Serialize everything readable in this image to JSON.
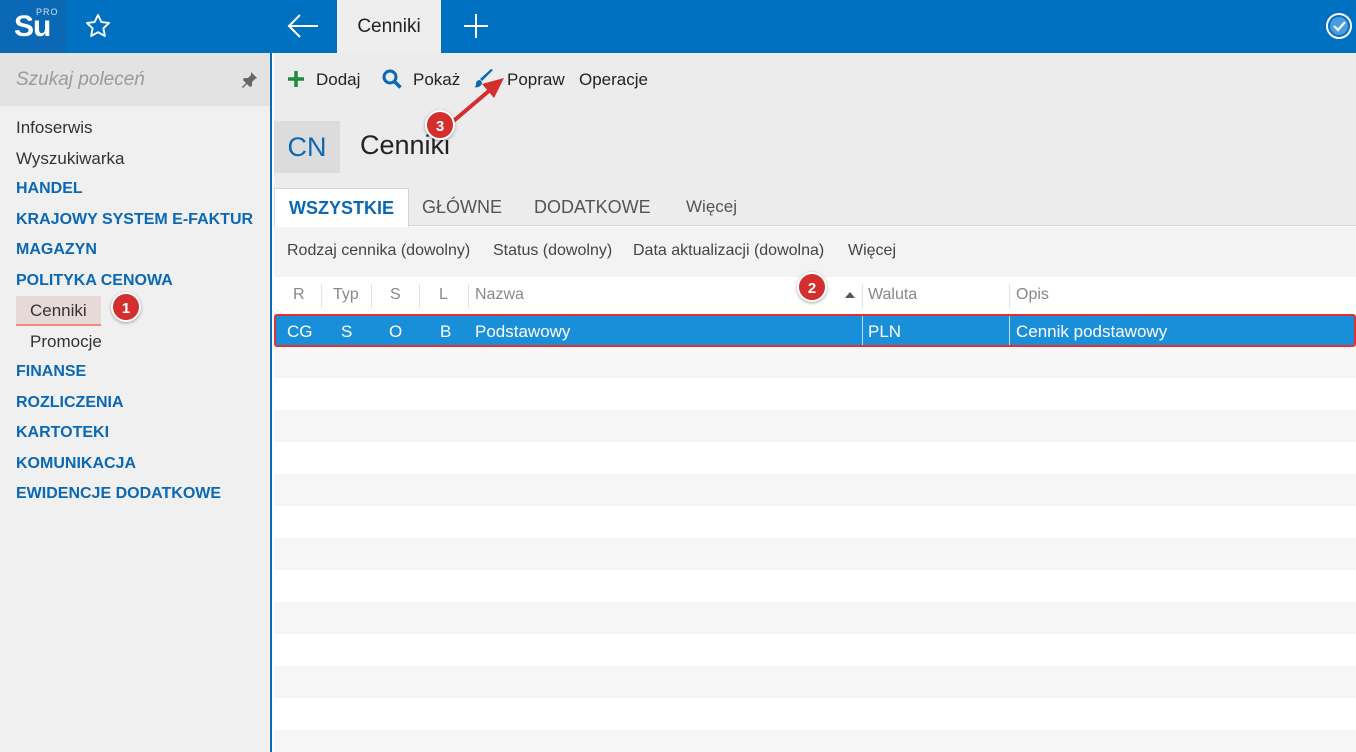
{
  "app": {
    "logo_text": "Su",
    "logo_sup": "PRO",
    "active_tab": "Cenniki"
  },
  "sidebar": {
    "search_placeholder": "Szukaj poleceń",
    "items": [
      {
        "label": "Infoserwis",
        "kind": "item"
      },
      {
        "label": "Wyszukiwarka",
        "kind": "item"
      },
      {
        "label": "HANDEL",
        "kind": "head"
      },
      {
        "label": "KRAJOWY SYSTEM E-FAKTUR",
        "kind": "head"
      },
      {
        "label": "MAGAZYN",
        "kind": "head"
      },
      {
        "label": "POLITYKA CENOWA",
        "kind": "head"
      },
      {
        "label": "Cenniki",
        "kind": "sub-selected"
      },
      {
        "label": "Promocje",
        "kind": "sub"
      },
      {
        "label": "FINANSE",
        "kind": "head"
      },
      {
        "label": "ROZLICZENIA",
        "kind": "head"
      },
      {
        "label": "KARTOTEKI",
        "kind": "head"
      },
      {
        "label": "KOMUNIKACJA",
        "kind": "head"
      },
      {
        "label": "EWIDENCJE DODATKOWE",
        "kind": "head"
      }
    ]
  },
  "toolbar": {
    "add": "Dodaj",
    "show": "Pokaż",
    "edit": "Popraw",
    "operations": "Operacje"
  },
  "header": {
    "code": "CN",
    "title": "Cenniki"
  },
  "tabs": [
    "WSZYSTKIE",
    "GŁÓWNE",
    "DODATKOWE",
    "Więcej"
  ],
  "filters": [
    "Rodzaj cennika (dowolny)",
    "Status (dowolny)",
    "Data aktualizacji (dowolna)",
    "Więcej"
  ],
  "grid": {
    "columns": [
      "R",
      "Typ",
      "S",
      "L",
      "Nazwa",
      "Waluta",
      "Opis"
    ],
    "rows": [
      {
        "r": "CG",
        "typ": "S",
        "s": "O",
        "l": "B",
        "nazwa": "Podstawowy",
        "waluta": "PLN",
        "opis": "Cennik podstawowy"
      }
    ]
  },
  "annotations": {
    "badge1": "1",
    "badge2": "2",
    "badge3": "3"
  },
  "colors": {
    "topbar": "#0070c0",
    "accent": "#0a68b4",
    "selected_row": "#1a8fd9",
    "highlight_border": "#e03030",
    "badge": "#d32f2f",
    "add_icon": "#1e8a3c"
  }
}
